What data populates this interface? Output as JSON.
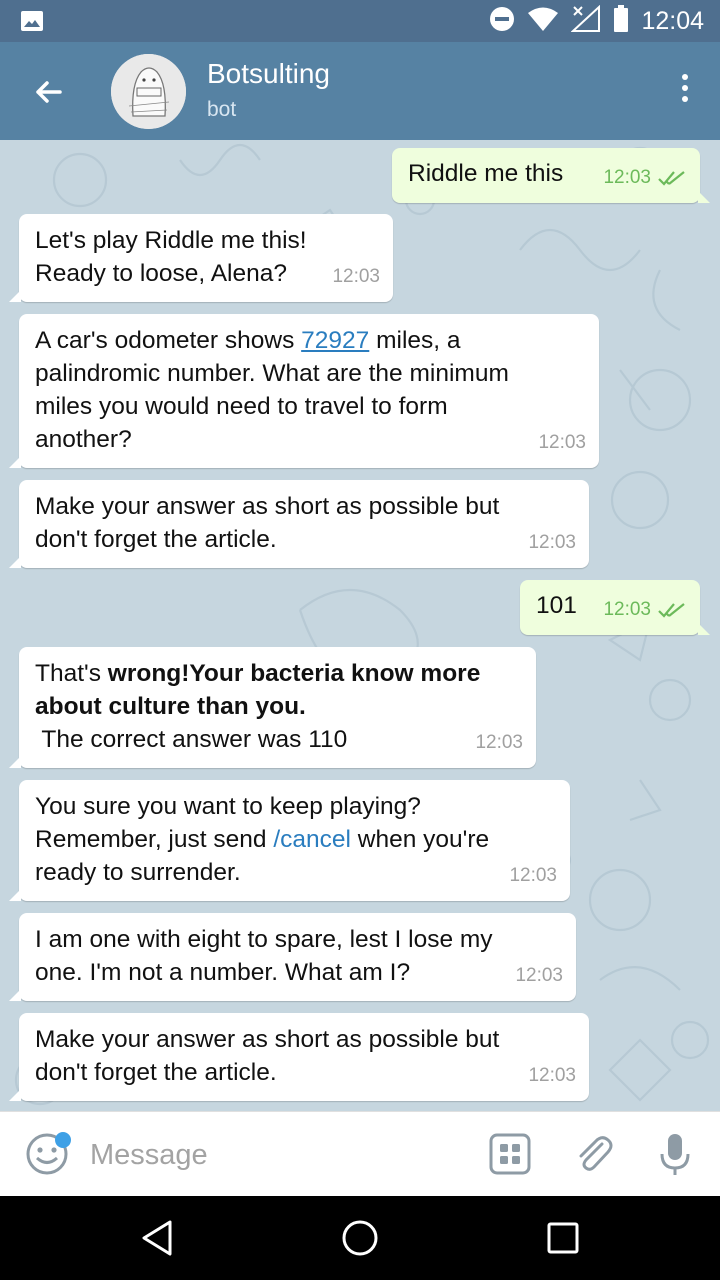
{
  "status_bar": {
    "time": "12:04",
    "icons": [
      "gallery-icon",
      "do-not-disturb-icon",
      "wifi-icon",
      "no-signal-icon",
      "battery-icon"
    ]
  },
  "header": {
    "title": "Botsulting",
    "subtitle": "bot",
    "icons": [
      "back-arrow-icon",
      "more-vert-icon"
    ]
  },
  "messages": [
    {
      "dir": "out",
      "text": "Riddle me this",
      "time": "12:03",
      "read": true
    },
    {
      "dir": "in",
      "lines": [
        "Let's play Riddle me this!",
        "Ready to loose, Alena?"
      ],
      "time": "12:03"
    },
    {
      "dir": "in",
      "pre": "A car's odometer shows ",
      "link": "72927",
      "post_lines": [
        " miles, a",
        "palindromic number. What are the minimum",
        "miles you would need to travel to form",
        "another?"
      ],
      "time": "12:03"
    },
    {
      "dir": "in",
      "lines": [
        "Make your answer as short as possible but",
        "don't forget the article."
      ],
      "time": "12:03"
    },
    {
      "dir": "out",
      "text": "101",
      "time": "12:03",
      "read": true
    },
    {
      "dir": "in",
      "plain1": "That's ",
      "bold1": "wrong!Your bacteria know more",
      "bold2": "about culture than you.",
      "line3": " The correct answer was 110",
      "time": "12:03"
    },
    {
      "dir": "in",
      "line1": "You sure you want to keep playing?",
      "line2_pre": "Remember, just send ",
      "command": "/cancel",
      "line2_post": " when you're",
      "line3": "ready to surrender.",
      "time": "12:03"
    },
    {
      "dir": "in",
      "lines": [
        "I am one with eight to spare, lest I lose my",
        "one. I'm not a number. What am I?"
      ],
      "time": "12:03"
    },
    {
      "dir": "in",
      "lines": [
        "Make your answer as short as possible but",
        "don't forget the article."
      ],
      "time": "12:03"
    }
  ],
  "input": {
    "placeholder": "Message",
    "icons": [
      "emoji-icon",
      "bot-keyboard-icon",
      "attach-icon",
      "microphone-icon"
    ]
  },
  "nav": {
    "icons": [
      "nav-back-icon",
      "nav-home-icon",
      "nav-recents-icon"
    ]
  },
  "colors": {
    "status_bar": "#4f6f8f",
    "app_bar": "#5682a3",
    "chat_bg": "#c6d6df",
    "incoming_bubble": "#ffffff",
    "outgoing_bubble": "#effedd",
    "link": "#2a7dbf",
    "read_check": "#6cba5a"
  }
}
